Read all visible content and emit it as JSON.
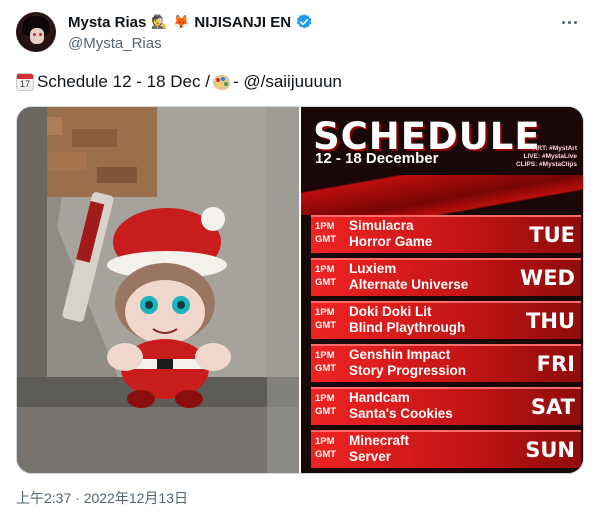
{
  "author": {
    "display_name": "Mysta Rias",
    "emoji1": "🕵",
    "emoji2": "🦊",
    "group": "NIJISANJI EN",
    "handle": "@Mysta_Rias",
    "verified_icon": "verified-badge-icon"
  },
  "tweet": {
    "calendar_number": "17",
    "text_part1": "Schedule 12 - 18 Dec / ",
    "text_part2": "- @/saiijuuuun"
  },
  "schedule_image": {
    "title": "SCHEDULE",
    "subtitle": "12 - 18 December",
    "credit_art": "ART: #MystArt",
    "credit_live": "LIVE: #MystaLive",
    "credit_clips": "CLIPS: #MystaClips",
    "rows": [
      {
        "time_top": "1PM",
        "time_bottom": "GMT",
        "line1": "Simulacra",
        "line2": "Horror Game",
        "day": "TUE"
      },
      {
        "time_top": "1PM",
        "time_bottom": "GMT",
        "line1": "Luxiem",
        "line2": "Alternate Universe",
        "day": "WED"
      },
      {
        "time_top": "1PM",
        "time_bottom": "GMT",
        "line1": "Doki Doki Lit",
        "line2": "Blind Playthrough",
        "day": "THU"
      },
      {
        "time_top": "1PM",
        "time_bottom": "GMT",
        "line1": "Genshin Impact",
        "line2": "Story Progression",
        "day": "FRI"
      },
      {
        "time_top": "1PM",
        "time_bottom": "GMT",
        "line1": "Handcam",
        "line2": "Santa's Cookies",
        "day": "SAT"
      },
      {
        "time_top": "1PM",
        "time_bottom": "GMT",
        "line1": "Minecraft",
        "line2": "Server",
        "day": "SUN"
      }
    ]
  },
  "timestamp": "上午2:37 · 2022年12月13日",
  "colors": {
    "verified": "#1d9bf0",
    "accent_red": "#e31b1b",
    "muted_text": "#536471"
  }
}
